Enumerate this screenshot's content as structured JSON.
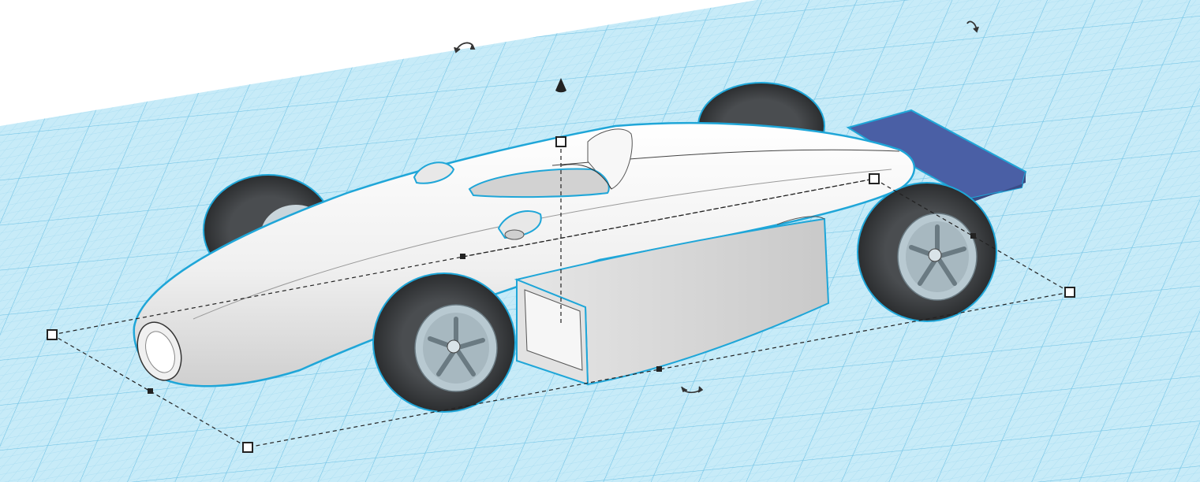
{
  "workplane": {
    "grid_fill": "#bfe8f7",
    "grid_line_minor": "#9bd6ee",
    "grid_line_major": "#6fc1e4",
    "edge_color": "#2a9fd6"
  },
  "model": {
    "body_color": "#f2f2f2",
    "body_shade": "#d4d4d4",
    "outline_color": "#1fa6d8",
    "tire_color": "#3a3d40",
    "rim_color": "#b8c9d1",
    "wing_color": "#4a5fa5",
    "selected": true
  },
  "icons": {
    "rotate_x": "rotate-arrow-icon",
    "rotate_y": "rotate-arrow-icon",
    "rotate_z": "rotate-arrow-icon",
    "lift": "cone-arrow-icon"
  }
}
